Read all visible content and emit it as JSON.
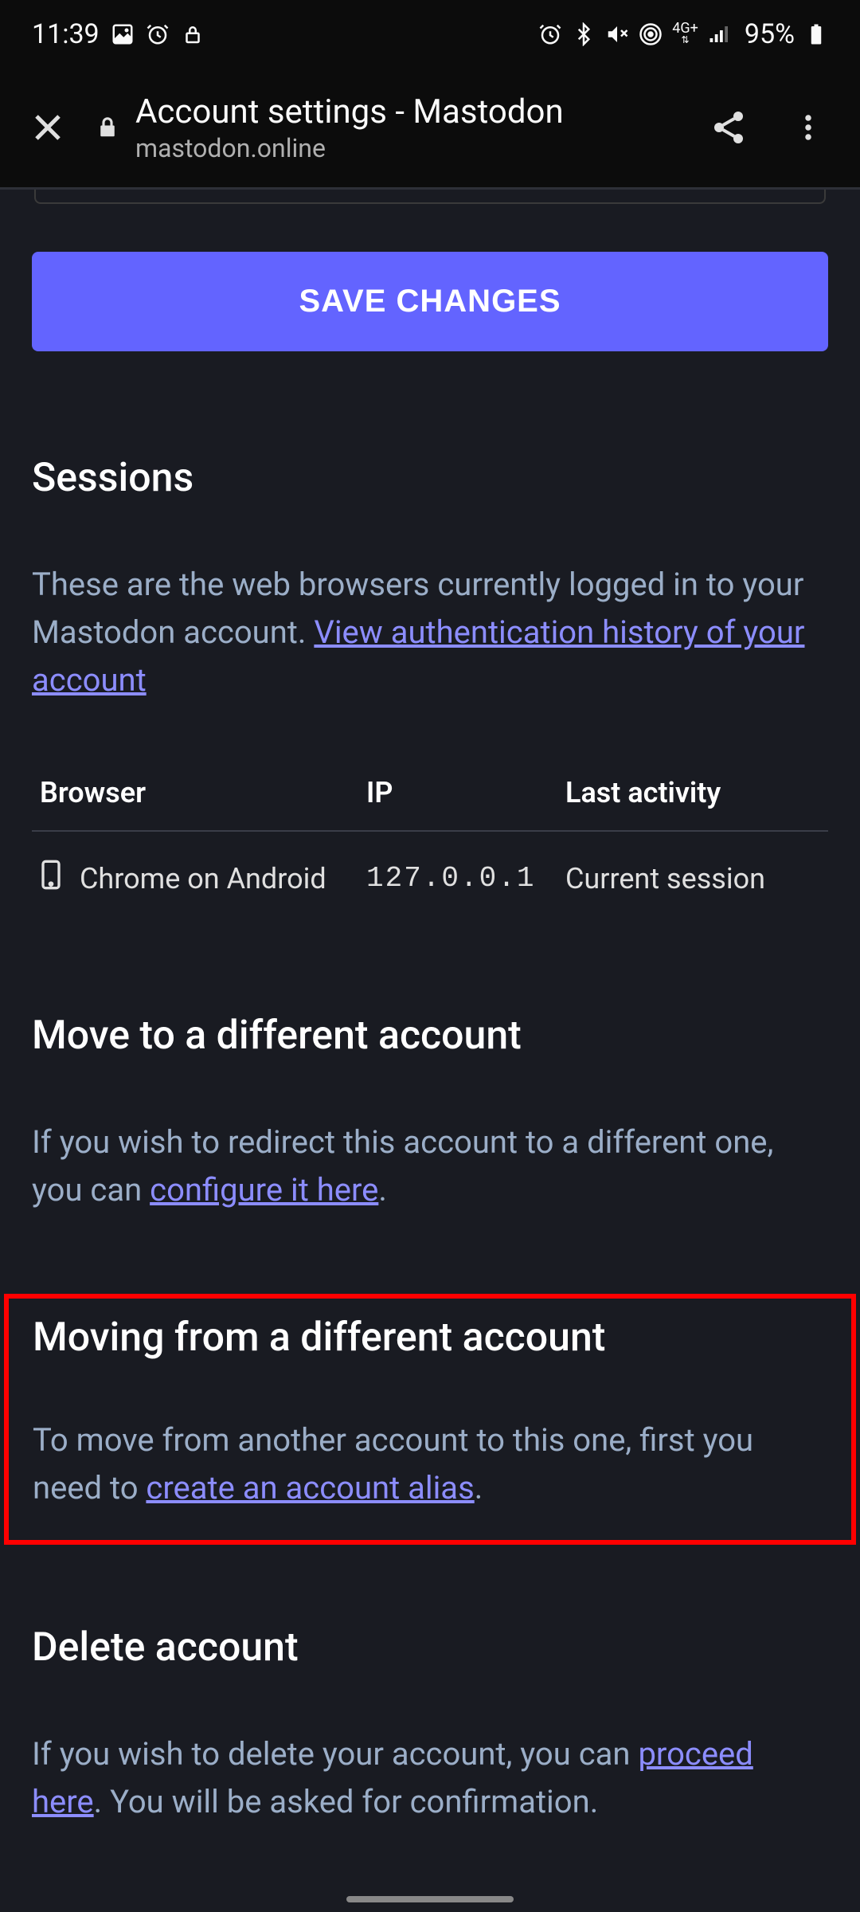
{
  "status": {
    "time": "11:39",
    "network_label": "4G+",
    "battery": "95%"
  },
  "chrome": {
    "title": "Account settings - Mastodon",
    "url": "mastodon.online"
  },
  "content": {
    "save_button": "SAVE CHANGES",
    "sessions": {
      "heading": "Sessions",
      "desc_prefix": "These are the web browsers currently logged in to your Mastodon account. ",
      "link": "View authentication history of your account",
      "table": {
        "headers": {
          "browser": "Browser",
          "ip": "IP",
          "activity": "Last activity"
        },
        "rows": [
          {
            "browser": "Chrome on Android",
            "ip": "127.0.0.1",
            "activity": "Current session"
          }
        ]
      }
    },
    "move_to": {
      "heading": "Move to a different account",
      "desc_prefix": "If you wish to redirect this account to a different one, you can ",
      "link": "configure it here",
      "desc_suffix": "."
    },
    "move_from": {
      "heading": "Moving from a different account",
      "desc_prefix": "To move from another account to this one, first you need to ",
      "link": "create an account alias",
      "desc_suffix": "."
    },
    "delete": {
      "heading": "Delete account",
      "desc_prefix": "If you wish to delete your account, you can ",
      "link": "proceed here",
      "desc_suffix": ". You will be asked for confirmation."
    }
  }
}
